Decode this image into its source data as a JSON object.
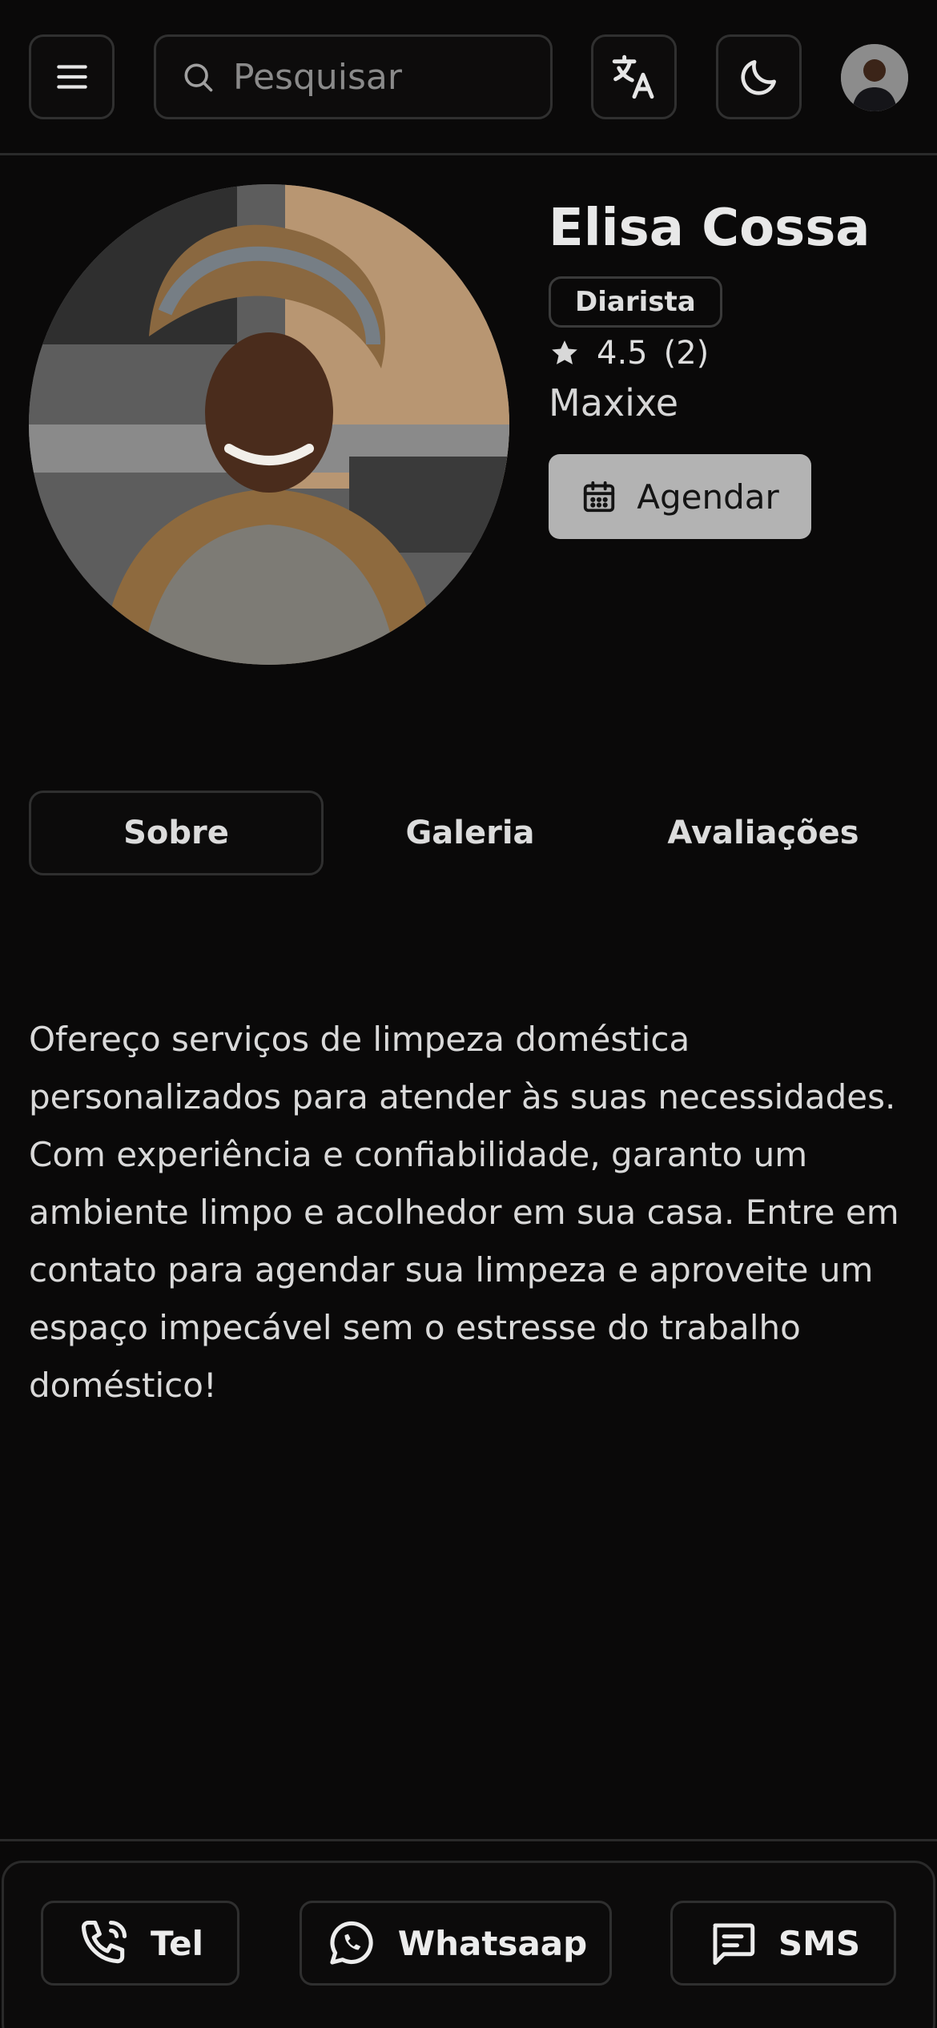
{
  "header": {
    "search_placeholder": "Pesquisar"
  },
  "profile": {
    "name": "Elisa Cossa",
    "role": "Diarista",
    "rating": "4.5",
    "reviews": "(2)",
    "location": "Maxixe",
    "book_label": "Agendar"
  },
  "tabs": [
    {
      "label": "Sobre",
      "active": true
    },
    {
      "label": "Galeria",
      "active": false
    },
    {
      "label": "Avaliações",
      "active": false
    }
  ],
  "about": {
    "text": "Ofereço serviços de limpeza doméstica personalizados para atender às suas necessidades. Com experiência e confiabilidade, garanto um ambiente limpo e acolhedor em sua casa. Entre em contato para agendar sua limpeza e aproveite um espaço impecável sem o estresse do trabalho doméstico!"
  },
  "contact": {
    "tel_label": "Tel",
    "whatsapp_label": "Whatsaap",
    "sms_label": "SMS"
  },
  "colors": {
    "background": "#0a0909",
    "accent_button": "#b3b3b3",
    "border": "#303030"
  },
  "icons": [
    "menu-icon",
    "search-icon",
    "translate-icon",
    "moon-icon",
    "star-icon",
    "calendar-icon",
    "phone-icon",
    "whatsapp-icon",
    "message-icon"
  ]
}
